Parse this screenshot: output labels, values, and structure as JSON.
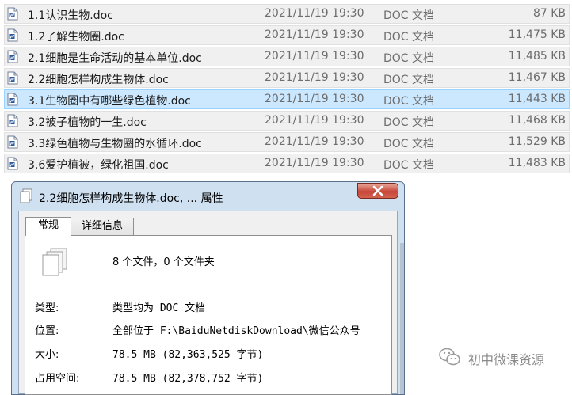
{
  "file_list": {
    "files": [
      {
        "name": "1.1认识生物.doc",
        "date": "2021/11/19 19:30",
        "type": "DOC 文档",
        "size": "87 KB"
      },
      {
        "name": "1.2了解生物圈.doc",
        "date": "2021/11/19 19:30",
        "type": "DOC 文档",
        "size": "11,475 KB"
      },
      {
        "name": "2.1细胞是生命活动的基本单位.doc",
        "date": "2021/11/19 19:30",
        "type": "DOC 文档",
        "size": "11,485 KB"
      },
      {
        "name": "2.2细胞怎样构成生物体.doc",
        "date": "2021/11/19 19:30",
        "type": "DOC 文档",
        "size": "11,467 KB"
      },
      {
        "name": "3.1生物圈中有哪些绿色植物.doc",
        "date": "2021/11/19 19:30",
        "type": "DOC 文档",
        "size": "11,443 KB"
      },
      {
        "name": "3.2被子植物的一生.doc",
        "date": "2021/11/19 19:30",
        "type": "DOC 文档",
        "size": "11,468 KB"
      },
      {
        "name": "3.3绿色植物与生物圈的水循环.doc",
        "date": "2021/11/19 19:30",
        "type": "DOC 文档",
        "size": "11,529 KB"
      },
      {
        "name": "3.6爱护植被，绿化祖国.doc",
        "date": "2021/11/19 19:30",
        "type": "DOC 文档",
        "size": "11,483 KB"
      }
    ],
    "selected_index": 4
  },
  "dialog": {
    "title": "2.2细胞怎样构成生物体.doc, ... 属性",
    "tabs": [
      {
        "label": "常规",
        "active": true
      },
      {
        "label": "详细信息",
        "active": false
      }
    ],
    "summary": "8 个文件，0 个文件夹",
    "properties": [
      {
        "label": "类型:",
        "value": "类型均为 DOC 文档"
      },
      {
        "label": "位置:",
        "value": "全部位于 F:\\BaiduNetdiskDownload\\微信公众号"
      },
      {
        "label": "大小:",
        "value": "78.5 MB (82,363,525 字节)"
      },
      {
        "label": "占用空间:",
        "value": "78.5 MB (82,378,752 字节)"
      }
    ]
  },
  "watermark": {
    "text": "初中微课资源",
    "icon": "wechat-icon"
  },
  "colors": {
    "row_bg": "#f0f0f0",
    "row_selected_bg": "#cce8ff",
    "dialog_frame": "#cfe0f1",
    "close_button": "#c7463a"
  }
}
